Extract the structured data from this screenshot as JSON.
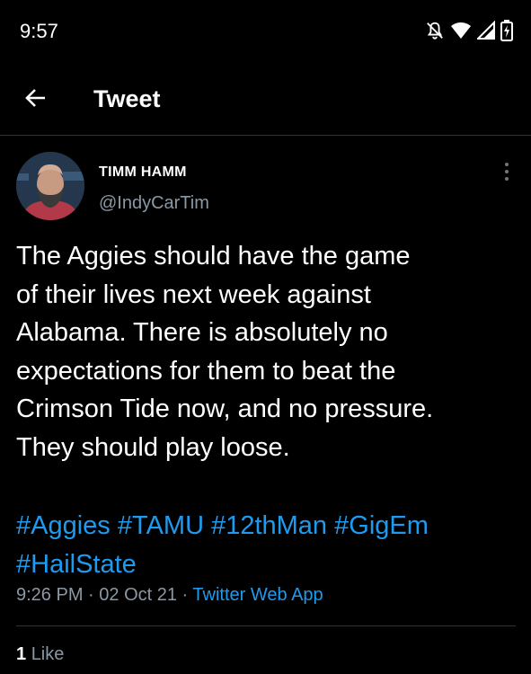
{
  "status_bar": {
    "time": "9:57",
    "icons": [
      "bell-off-icon",
      "wifi-icon",
      "signal-icon",
      "battery-charging-icon"
    ]
  },
  "header": {
    "back_icon": "arrow-left-icon",
    "title": "Tweet"
  },
  "tweet": {
    "author": {
      "name": "TIMM HAMM",
      "handle": "@IndyCarTim"
    },
    "text_lines": [
      "The Aggies should have the game",
      "of their lives next week against",
      "Alabama. There is absolutely no",
      "expectations for them to beat the",
      "Crimson Tide now, and no pressure.",
      "They should play loose."
    ],
    "hashtags": [
      "#Aggies",
      "#TAMU",
      "#12thMan",
      "#GigEm",
      "#HailState"
    ],
    "time": "9:26 PM",
    "date": "02 Oct 21",
    "separator": " · ",
    "source": "Twitter Web App",
    "likes_count": "1",
    "likes_label": "Like"
  },
  "colors": {
    "background": "#000000",
    "text": "#ffffff",
    "secondary": "#8b98a5",
    "link": "#1d9bf0",
    "divider": "#2f3336"
  }
}
